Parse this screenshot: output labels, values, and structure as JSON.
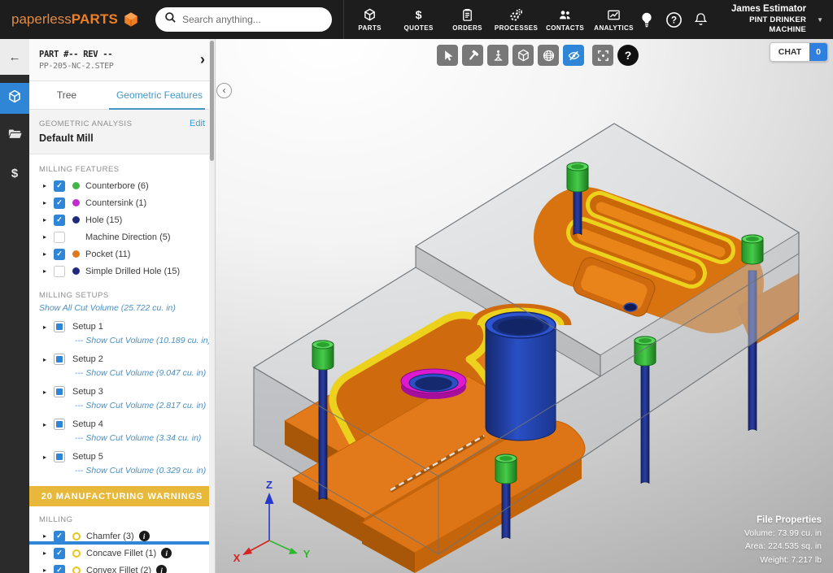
{
  "topnav": {
    "logo": {
      "light": "paperless",
      "bold": "PARTS"
    },
    "search_placeholder": "Search anything...",
    "items": [
      {
        "label": "PARTS",
        "icon": "cube-icon"
      },
      {
        "label": "QUOTES",
        "icon": "dollar-icon"
      },
      {
        "label": "ORDERS",
        "icon": "clipboard-icon"
      },
      {
        "label": "PROCESSES",
        "icon": "gears-icon"
      },
      {
        "label": "CONTACTS",
        "icon": "people-icon"
      },
      {
        "label": "ANALYTICS",
        "icon": "chart-icon"
      }
    ],
    "user": {
      "name": "James Estimator",
      "org": "PINT DRINKER MACHINE"
    }
  },
  "panel": {
    "part_label": "PART #-- REV --",
    "file_name": "PP-205-NC-2.STEP",
    "tabs": [
      "Tree",
      "Geometric Features"
    ],
    "analysis": {
      "heading": "GEOMETRIC ANALYSIS",
      "edit_label": "Edit",
      "name": "Default Mill"
    },
    "features": {
      "heading": "MILLING FEATURES",
      "items": [
        {
          "label": "Counterbore (6)",
          "checked": true,
          "dot": "#43b649"
        },
        {
          "label": "Countersink (1)",
          "checked": true,
          "dot": "#c32bd1"
        },
        {
          "label": "Hole (15)",
          "checked": true,
          "dot": "#1f2a7d"
        },
        {
          "label": "Machine Direction (5)",
          "checked": false
        },
        {
          "label": "Pocket (11)",
          "checked": true,
          "dot": "#e0791c"
        },
        {
          "label": "Simple Drilled Hole (15)",
          "checked": false,
          "dot": "#1f2a7d"
        }
      ]
    },
    "setups": {
      "heading": "MILLING SETUPS",
      "show_all": "Show All Cut Volume (25.722 cu. in)",
      "items": [
        {
          "label": "Setup 1",
          "volume": "--- Show Cut Volume (10.189 cu. in)"
        },
        {
          "label": "Setup 2",
          "volume": "--- Show Cut Volume (9.047 cu. in)"
        },
        {
          "label": "Setup 3",
          "volume": "--- Show Cut Volume (2.817 cu. in)"
        },
        {
          "label": "Setup 4",
          "volume": "--- Show Cut Volume (3.34 cu. in)"
        },
        {
          "label": "Setup 5",
          "volume": "--- Show Cut Volume (0.329 cu. in)"
        }
      ]
    },
    "warnings_banner": "20 MANUFACTURING WARNINGS",
    "warnings": {
      "heading": "MILLING",
      "ring_color": "#e7c51f",
      "items": [
        {
          "label": "Chamfer (3)"
        },
        {
          "label": "Concave Fillet (1)"
        },
        {
          "label": "Convex Fillet (2)"
        }
      ]
    }
  },
  "viewer": {
    "toolbar_icons": [
      "cursor-icon",
      "tools-icon",
      "machine-icon",
      "cube-icon",
      "globe-icon",
      "hide-features-icon",
      "focus-icon",
      "help-icon"
    ],
    "chat": {
      "label": "CHAT",
      "count": "0"
    },
    "axes": {
      "x": "X",
      "y": "Y",
      "z": "Z"
    },
    "file_properties": {
      "title": "File Properties",
      "volume": "Volume: 73.99 cu. in",
      "area": "Area: 224.535 sq. in",
      "weight": "Weight: 7.217 lb"
    }
  },
  "colors": {
    "accent_blue": "#2f86d6",
    "banner_gold": "#e8b83a",
    "link_blue": "#4a90c4",
    "nav_bg": "#1d1d1d",
    "logo_orange": "#f07f23",
    "model": {
      "stock": "#b9bdc2",
      "pocket": "#e2791a",
      "chamfer": "#ecd11d",
      "hole": "#2a50c8",
      "counterbore": "#35b83a",
      "countersink": "#da18ce",
      "pin": "#1d2f92"
    }
  }
}
